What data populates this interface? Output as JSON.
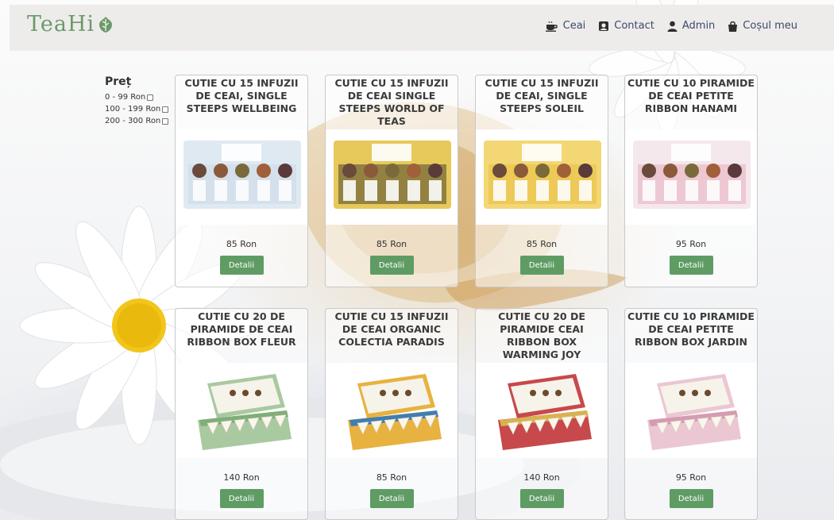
{
  "brand": {
    "logo_text": "TeaHi"
  },
  "nav": {
    "items": [
      {
        "label": "Ceai",
        "icon": "tea-cup-icon"
      },
      {
        "label": "Contact",
        "icon": "contact-icon"
      },
      {
        "label": "Admin",
        "icon": "user-icon"
      },
      {
        "label": "Coșul meu",
        "icon": "shopping-bag-icon"
      }
    ]
  },
  "filter": {
    "title": "Preț",
    "options": [
      "0 - 99 Ron",
      "100 - 199 Ron",
      "200 - 300 Ron"
    ]
  },
  "products": [
    {
      "title": "CUTIE CU 15 INFUZII DE CEAI, SINGLE STEEPS WELLBEING",
      "price": "85 Ron",
      "button": "Detalii",
      "box_color": "#dfe9f1",
      "accent": "#c9d8e6"
    },
    {
      "title": "CUTIE CU 15 INFUZII DE CEAI SINGLE STEEPS WORLD OF TEAS",
      "price": "85 Ron",
      "button": "Detalii",
      "box_color": "#e6c95a",
      "accent": "#3f3a2a"
    },
    {
      "title": "CUTIE CU 15 INFUZII DE CEAI, SINGLE STEEPS SOLEIL",
      "price": "85 Ron",
      "button": "Detalii",
      "box_color": "#f3d774",
      "accent": "#e7bd3b"
    },
    {
      "title": "CUTIE CU 10 PIRAMIDE DE CEAI PETITE RIBBON HANAMI",
      "price": "95 Ron",
      "button": "Detalii",
      "box_color": "#f4e8ec",
      "accent": "#e6a7b8"
    },
    {
      "title": "CUTIE CU 20 DE PIRAMIDE DE CEAI RIBBON BOX FLEUR",
      "price": "140 Ron",
      "button": "Detalii",
      "box_color": "#a9c9a0",
      "accent": "#7fae78"
    },
    {
      "title": "CUTIE CU 15 INFUZII DE CEAI ORGANIC COLECTIA PARADIS",
      "price": "85 Ron",
      "button": "Detalii",
      "box_color": "#e7b23f",
      "accent": "#3f7fb0"
    },
    {
      "title": "CUTIE CU 20 DE PIRAMIDE CEAI RIBBON BOX WARMING JOY",
      "price": "140 Ron",
      "button": "Detalii",
      "box_color": "#c7494b",
      "accent": "#d8b24e"
    },
    {
      "title": "CUTIE CU 10 PIRAMIDE DE CEAI PETITE RIBBON BOX JARDIN",
      "price": "95 Ron",
      "button": "Detalii",
      "box_color": "#ebc7d3",
      "accent": "#d49cb1"
    }
  ]
}
